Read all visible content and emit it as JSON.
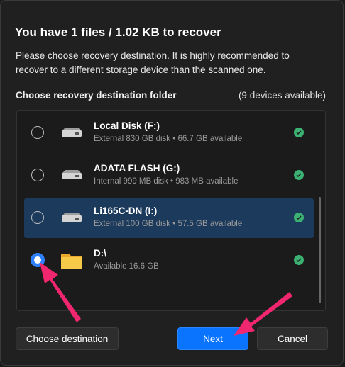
{
  "dialog": {
    "title": "You have 1 files / 1.02 KB to recover",
    "subtitle": "Please choose recovery destination. It is highly recommended to recover to a different storage device than the scanned one.",
    "section_label": "Choose recovery destination folder",
    "devices_count": "(9 devices available)"
  },
  "devices": [
    {
      "name": "Local Disk (F:)",
      "detail": "External 830 GB disk • 66.7 GB available",
      "icon": "drive-icon",
      "selected": false,
      "checked": false
    },
    {
      "name": "ADATA FLASH (G:)",
      "detail": "Internal 999 MB disk • 983 MB available",
      "icon": "drive-icon",
      "selected": false,
      "checked": false
    },
    {
      "name": "Li165C-DN (I:)",
      "detail": "External 100 GB disk • 57.5 GB available",
      "icon": "drive-icon",
      "selected": true,
      "checked": false
    },
    {
      "name": "D:\\",
      "detail": "Available 16.6 GB",
      "icon": "folder-icon",
      "selected": false,
      "checked": true
    }
  ],
  "buttons": {
    "choose_destination": "Choose destination",
    "next": "Next",
    "cancel": "Cancel"
  },
  "colors": {
    "accent": "#0a74ff",
    "selected_row": "#1c3a5c",
    "status_ok": "#3bb273",
    "annotation_arrow": "#f0266f"
  }
}
